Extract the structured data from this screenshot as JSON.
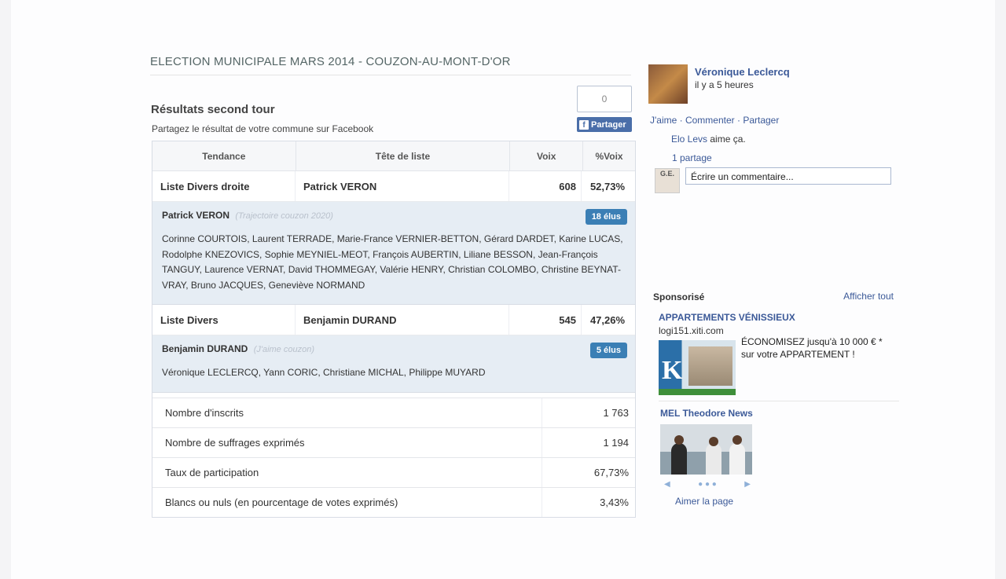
{
  "header": {
    "title": "ELECTION MUNICIPALE MARS 2014 - COUZON-AU-MONT-D'OR",
    "subtitle": "Résultats second tour",
    "share_text": "Partagez le résultat de votre commune sur Facebook",
    "share_count": "0",
    "share_button": "Partager",
    "fb_icon": "f"
  },
  "table": {
    "columns": [
      "Tendance",
      "Tête de liste",
      "Voix",
      "%Voix"
    ],
    "lists": [
      {
        "tendance": "Liste Divers droite",
        "tete": "Patrick VERON",
        "voix": "608",
        "pct": "52,73%",
        "leader": "Patrick VERON",
        "group": "(Trajectoire couzon 2020)",
        "elus": "18 élus",
        "members": "Corinne COURTOIS, Laurent TERRADE, Marie-France VERNIER-BETTON, Gérard DARDET, Karine LUCAS, Rodolphe KNEZOVICS, Sophie MEYNIEL-MEOT, François AUBERTIN, Liliane BESSON, Jean-François TANGUY, Laurence VERNAT, David THOMMEGAY, Valérie HENRY, Christian COLOMBO, Christine BEYNAT-VRAY, Bruno JACQUES, Geneviève NORMAND"
      },
      {
        "tendance": "Liste Divers",
        "tete": "Benjamin DURAND",
        "voix": "545",
        "pct": "47,26%",
        "leader": "Benjamin DURAND",
        "group": "(J'aime couzon)",
        "elus": "5 élus",
        "members": "Véronique LECLERCQ, Yann CORIC, Christiane MICHAL, Philippe MUYARD"
      }
    ],
    "stats": [
      {
        "label": "Nombre d'inscrits",
        "value": "1 763"
      },
      {
        "label": "Nombre de suffrages exprimés",
        "value": "1 194"
      },
      {
        "label": "Taux de participation",
        "value": "67,73%"
      },
      {
        "label": "Blancs ou nuls (en pourcentage de votes exprimés)",
        "value": "3,43%"
      }
    ]
  },
  "facebook_post": {
    "author": "Véronique Leclercq",
    "time": "il y a 5 heures",
    "actions": "J'aime · Commenter · Partager",
    "liker": "Elo Levs",
    "likes_suffix": " aime ça.",
    "shares": "1 partage",
    "commenter_avatar_text": "G.E.",
    "comment_placeholder": "Écrire un commentaire..."
  },
  "sponsored": {
    "title": "Sponsorisé",
    "see_all": "Afficher tout",
    "ad1": {
      "title": "APPARTEMENTS VÉNISSIEUX",
      "domain": "logi151.xiti.com",
      "image_letter": "K",
      "text": "ÉCONOMISEZ jusqu'à 10 000 € * sur votre APPARTEMENT !"
    },
    "ad2": {
      "title": "MEL Theodore News",
      "dots": "● ● ●",
      "prev": "◀",
      "next": "▶",
      "like_page": "Aimer la page"
    }
  },
  "colors": {
    "link": "#3b5998",
    "badge": "#3b7fb5",
    "detail_bg": "#e6edf4",
    "share_btn": "#4a6ea9"
  }
}
